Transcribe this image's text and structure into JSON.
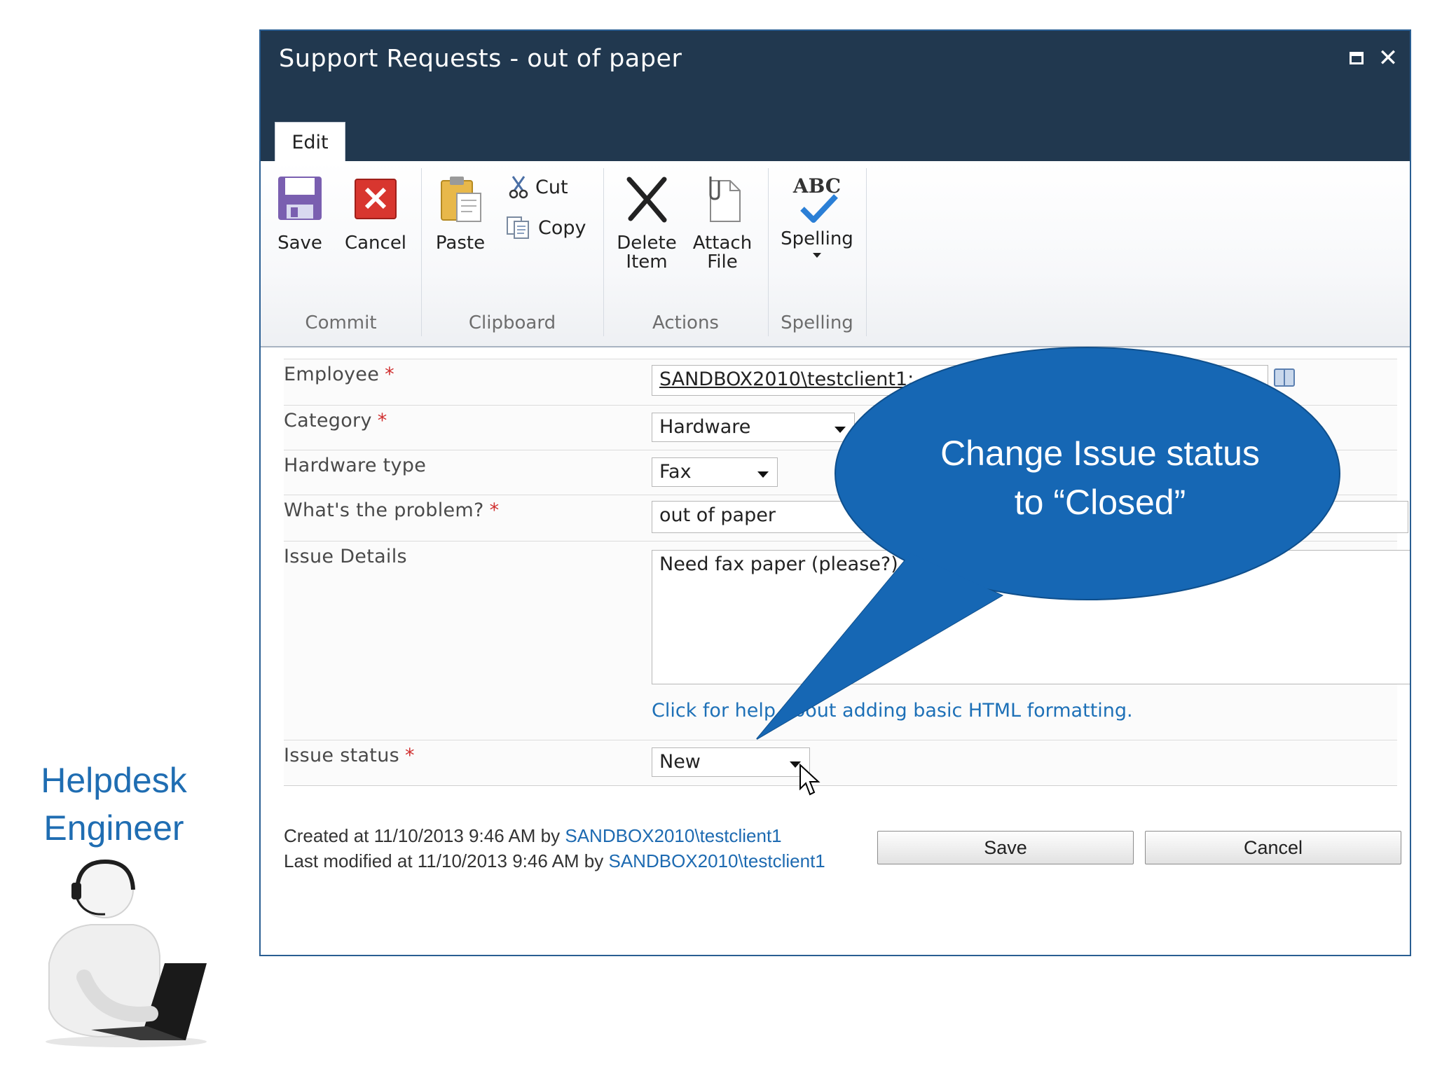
{
  "side": {
    "helpdesk_line1": "Helpdesk",
    "helpdesk_line2": "Engineer"
  },
  "dialog": {
    "title": "Support Requests - out of paper",
    "window_controls": [
      "maximize-icon",
      "close-icon"
    ],
    "active_tab": "Edit"
  },
  "ribbon": {
    "groups": {
      "commit": "Commit",
      "clipboard": "Clipboard",
      "actions": "Actions",
      "spelling": "Spelling"
    },
    "buttons": {
      "save": "Save",
      "cancel": "Cancel",
      "paste": "Paste",
      "cut": "Cut",
      "copy": "Copy",
      "delete_line1": "Delete",
      "delete_line2": "Item",
      "attach_line1": "Attach",
      "attach_line2": "File",
      "spelling": "Spelling",
      "spelling_icon_text": "ABC"
    }
  },
  "form": {
    "required_marker": "*",
    "employee": {
      "label": "Employee",
      "value": "SANDBOX2010\\testclient1;"
    },
    "category": {
      "label": "Category",
      "value": "Hardware"
    },
    "hardware_type": {
      "label": "Hardware type",
      "value": "Fax"
    },
    "problem": {
      "label": "What's the problem?",
      "value": "out of paper"
    },
    "issue_details": {
      "label": "Issue Details",
      "value": "Need fax paper (please?)"
    },
    "help_link": "Click for help about adding basic HTML formatting.",
    "issue_status": {
      "label": "Issue status",
      "value": "New"
    }
  },
  "meta": {
    "created_prefix": "Created at 11/10/2013 9:46 AM by ",
    "created_by": "SANDBOX2010\\testclient1",
    "modified_prefix": "Last modified at 11/10/2013 9:46 AM by ",
    "modified_by": "SANDBOX2010\\testclient1"
  },
  "footer_buttons": {
    "save": "Save",
    "cancel": "Cancel"
  },
  "callout": {
    "line1": "Change Issue status",
    "line2": "to “Closed”",
    "color": "#1667b4"
  },
  "colors": {
    "titlebar": "#21384f",
    "link": "#1d70b7",
    "required": "#d03030"
  }
}
